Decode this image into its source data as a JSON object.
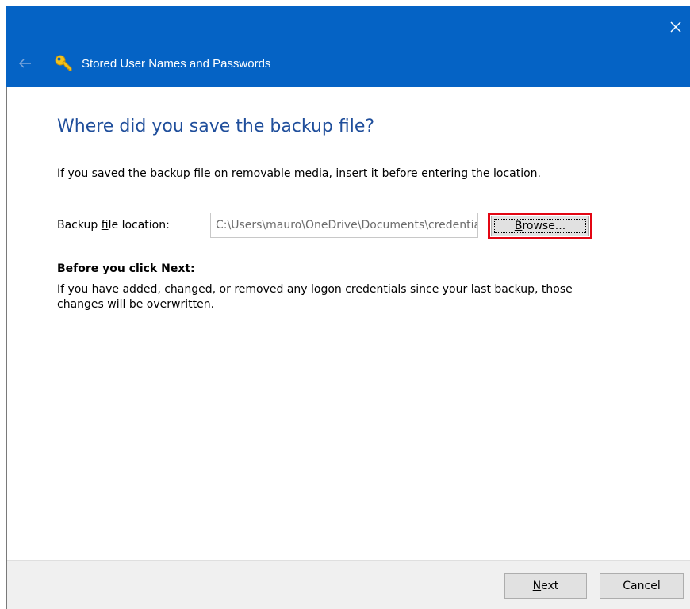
{
  "window": {
    "title": "Stored User Names and Passwords",
    "accent_color": "#0563c5",
    "icons": {
      "back": "back-arrow-icon",
      "app": "key-icon",
      "close": "close-icon"
    }
  },
  "page": {
    "heading": "Where did you save the backup file?",
    "intro": "If you saved the backup file on removable media, insert it before entering the location.",
    "location": {
      "label_before": "Backup ",
      "label_accel": "f",
      "label_after": "ile location:",
      "value": "C:\\Users\\mauro\\OneDrive\\Documents\\credentials.crd"
    },
    "browse": {
      "accel": "B",
      "label_rest": "rowse...",
      "highlight_color": "#e30613"
    },
    "note": {
      "heading": "Before you click Next:",
      "text": "If you have added, changed, or removed any logon credentials since your last backup, those changes will be overwritten."
    }
  },
  "footer": {
    "next": {
      "accel": "N",
      "label_rest": "ext"
    },
    "cancel_label": "Cancel"
  }
}
